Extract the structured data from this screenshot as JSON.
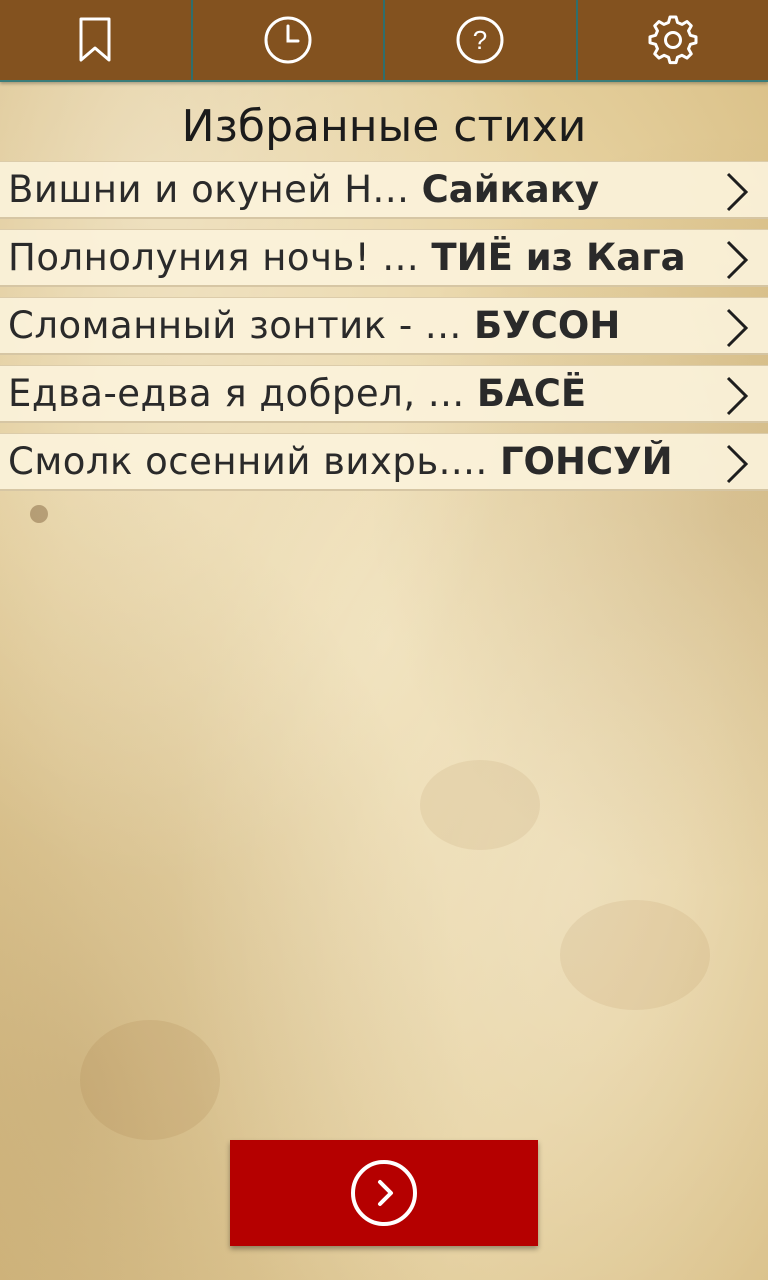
{
  "toolbar": {
    "buttons": [
      {
        "icon": "bookmark-icon"
      },
      {
        "icon": "clock-icon"
      },
      {
        "icon": "help-icon"
      },
      {
        "icon": "gear-icon"
      }
    ],
    "help_glyph": "?"
  },
  "page": {
    "title": "Избранные стихи"
  },
  "favorites": [
    {
      "excerpt": "Вишни и окуней Н... ",
      "author": "Сайкаку"
    },
    {
      "excerpt": "Полнолуния ночь! ... ",
      "author": "ТИЁ из Кага"
    },
    {
      "excerpt": "Сломанный зонтик - ... ",
      "author": "БУСОН"
    },
    {
      "excerpt": "Едва-едва я добрел, ... ",
      "author": "БАСЁ"
    },
    {
      "excerpt": "Смолк осенний вихрь.... ",
      "author": "ГОНСУЙ"
    }
  ],
  "next_button": {
    "icon": "arrow-right-circle-icon"
  },
  "colors": {
    "toolbar": "#83521f",
    "toolbar_divider": "#2f6e6c",
    "next_button": "#b50000",
    "text": "#2a2a2a"
  }
}
